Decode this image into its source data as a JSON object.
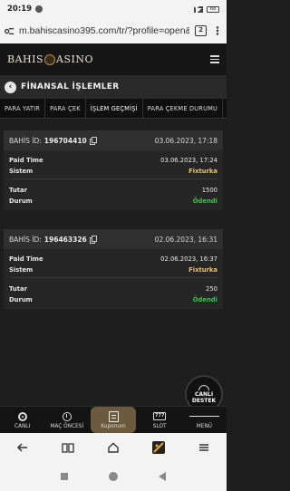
{
  "status_bar": {
    "time": "20:19",
    "battery": "68"
  },
  "browser": {
    "url": "m.bahiscasino395.com/tr/?profile=open&ac",
    "tab_count": "2"
  },
  "site": {
    "logo": "BAHISCASINO",
    "logo_left": "BAHIS",
    "logo_right": "ASINO"
  },
  "page": {
    "title": "FİNANSAL İŞLEMLER"
  },
  "tabs": [
    {
      "label": "PARA YATIR"
    },
    {
      "label": "PARA ÇEK"
    },
    {
      "label": "İŞLEM GEÇMİŞİ"
    },
    {
      "label": "PARA ÇEKME DURUMU"
    }
  ],
  "transactions": [
    {
      "bet_id_label": "BAHİS İD:",
      "bet_id": "196704410",
      "date": "03.06.2023, 17:18",
      "paid_time_label": "Paid Time",
      "paid_time": "03.06.2023, 17:24",
      "system_label": "Sistem",
      "system": "Fixturka",
      "amount_label": "Tutar",
      "amount": "1500",
      "status_label": "Durum",
      "status": "Ödendi"
    },
    {
      "bet_id_label": "BAHİS İD:",
      "bet_id": "196463326",
      "date": "02.06.2023, 16:31",
      "paid_time_label": "Paid Time",
      "paid_time": "02.06.2023, 16:37",
      "system_label": "Sistem",
      "system": "Fixturka",
      "amount_label": "Tutar",
      "amount": "250",
      "status_label": "Durum",
      "status": "Ödendi"
    }
  ],
  "live_support": {
    "line1": "CANLI",
    "line2": "DESTEK"
  },
  "bottom_nav": [
    {
      "label": "CANLI",
      "icon": "live-icon"
    },
    {
      "label": "MAÇ ÖNCESİ",
      "icon": "timer-icon"
    },
    {
      "label": "Kuponum",
      "icon": "coupon-icon"
    },
    {
      "label": "SLOT",
      "icon": "slot-icon"
    },
    {
      "label": "MENÜ",
      "icon": "menu-icon"
    }
  ],
  "slot_icon_text": "777",
  "colors": {
    "accent_gold": "#e9c36a",
    "status_green": "#3cc24a",
    "active_nav": "#6b5a3e"
  }
}
